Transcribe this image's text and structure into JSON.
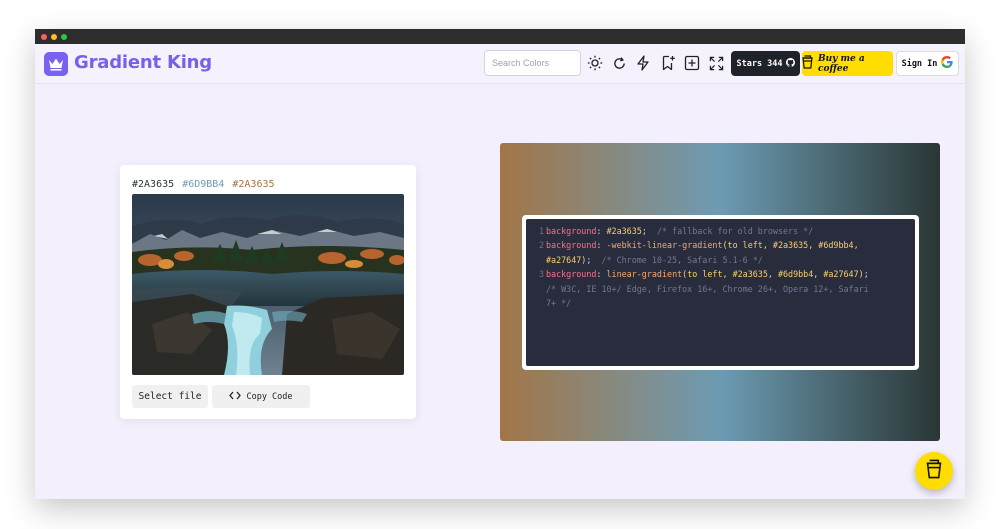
{
  "app": {
    "brand": "Gradient King"
  },
  "search": {
    "placeholder": "Search Colors"
  },
  "toolbar": {
    "icons": [
      "sun-icon",
      "refresh-icon",
      "lightning-icon",
      "bookmark-plus-icon",
      "add-square-icon",
      "fullscreen-icon"
    ],
    "stars_label": "Stars 344",
    "coffee_label": "Buy me a coffee",
    "signin_label": "Sign In"
  },
  "colors": {
    "c1": "#2A3635",
    "c2": "#6D9BB4",
    "c3": "#2A3635",
    "c1_display": "#2A3635",
    "c2_display": "#6D9BB4",
    "c3_display": "#2A3635",
    "accent": "#7860ea",
    "gradient_start": "#a27647",
    "gradient_mid": "#6d9bb4",
    "gradient_end": "#2a3635"
  },
  "card": {
    "select_file_label": "Select file",
    "copy_code_label": "Copy Code"
  },
  "code": {
    "line1_prop": "background",
    "line1_value": "#2a3635",
    "line1_comment": "/* fallback for old browsers */",
    "line2_prop": "background",
    "line2_func": "-webkit-linear-gradient",
    "line2_args": "(to left, #2a3635, #6d9bb4,",
    "line2b_value": "#a27647",
    "line2b_comment": "/* Chrome 10-25, Safari 5.1-6 */",
    "line3_prop": "background",
    "line3_func": "linear-gradient",
    "line3_args": "(to left, #2a3635, #6d9bb4, #a27647)",
    "line3b_comment": "/* W3C, IE 10+/ Edge, Firefox 16+, Chrome 26+, Opera 12+, Safari",
    "line3c_comment": "7+ */"
  }
}
